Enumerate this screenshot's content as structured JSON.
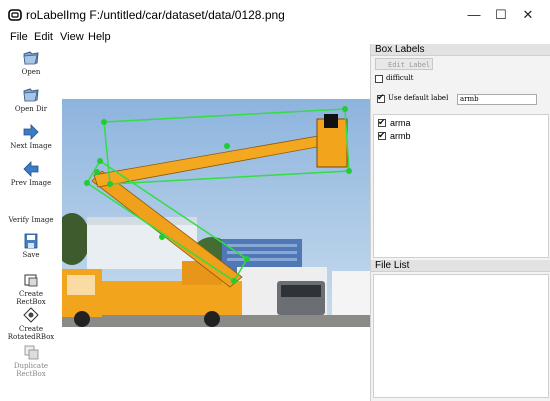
{
  "window": {
    "title": "roLabelImg F:/untitled/car/dataset/data/0128.png",
    "minimize_glyph": "—",
    "maximize_glyph": "☐",
    "close_glyph": "✕"
  },
  "menu": [
    "File",
    "Edit",
    "View",
    "Help"
  ],
  "toolbar": [
    {
      "label": "Open",
      "icon": "open-folder-icon"
    },
    {
      "label": "Open Dir",
      "icon": "open-dir-icon"
    },
    {
      "label": "Next Image",
      "icon": "next-arrow-icon"
    },
    {
      "label": "Prev Image",
      "icon": "prev-arrow-icon"
    },
    {
      "label": "Verify Image",
      "icon": "verify-icon"
    },
    {
      "label": "Save",
      "icon": "save-disk-icon"
    },
    {
      "label": "Create\nRectBox",
      "icon": "create-rectbox-icon"
    },
    {
      "label": "Create\nRotatedRBox",
      "icon": "create-rotated-box-icon"
    },
    {
      "label": "Duplicate\nRectBox",
      "icon": "duplicate-rectbox-icon"
    }
  ],
  "box_labels": {
    "title": "Box Labels",
    "edit_label": "Edit Label",
    "difficult_label": "difficult",
    "difficult_checked": false,
    "use_default_label": "Use default label",
    "use_default_checked": true,
    "default_label_value": "armb",
    "labels": [
      {
        "name": "arma",
        "checked": true
      },
      {
        "name": "armb",
        "checked": true
      }
    ]
  },
  "file_list": {
    "title": "File List",
    "items": []
  },
  "colors": {
    "bbox": "#33dd44",
    "vertex": "#22cc33",
    "truck": "#f2a51c",
    "sky": "#a9c8e6"
  }
}
